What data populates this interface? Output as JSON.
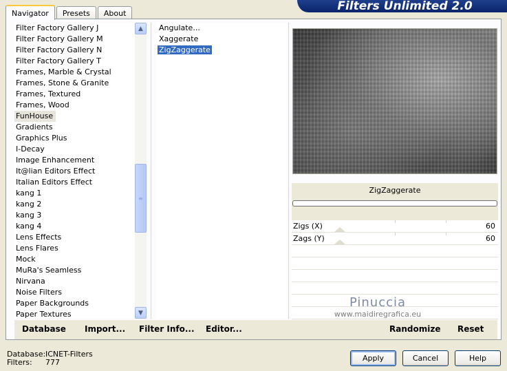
{
  "tabs": [
    "Navigator",
    "Presets",
    "About"
  ],
  "banner": "Filters Unlimited 2.0",
  "categories": [
    "Filter Factory Gallery J",
    "Filter Factory Gallery M",
    "Filter Factory Gallery N",
    "Filter Factory Gallery T",
    "Frames, Marble & Crystal",
    "Frames, Stone & Granite",
    "Frames, Textured",
    "Frames, Wood",
    "FunHouse",
    "Gradients",
    "Graphics Plus",
    "I-Decay",
    "Image Enhancement",
    "It@lian Editors Effect",
    "Italian Editors Effect",
    "kang 1",
    "kang 2",
    "kang 3",
    "kang 4",
    "Lens Effects",
    "Lens Flares",
    "Mock",
    "MuRa's Seamless",
    "Nirvana",
    "Noise Filters",
    "Paper Backgrounds",
    "Paper Textures"
  ],
  "selected_category": "FunHouse",
  "filters": [
    "Angulate...",
    "Xaggerate",
    "ZigZaggerate"
  ],
  "selected_filter": "ZigZaggerate",
  "preview": {
    "filter_title": "ZigZaggerate"
  },
  "params": [
    {
      "label": "Zigs (X)",
      "value": "60"
    },
    {
      "label": "Zags (Y)",
      "value": "60"
    }
  ],
  "watermark": {
    "name": "Pinuccia",
    "url": "www.maidiregrafica.eu"
  },
  "panel_buttons": {
    "database": "Database",
    "import": "Import...",
    "filter_info": "Filter Info...",
    "editor": "Editor...",
    "randomize": "Randomize",
    "reset": "Reset"
  },
  "status": {
    "database_label": "Database:",
    "database_value": "ICNET-Filters",
    "filters_label": "Filters:",
    "filters_value": "777"
  },
  "dialog_buttons": {
    "apply": "Apply",
    "cancel": "Cancel",
    "help": "Help"
  }
}
